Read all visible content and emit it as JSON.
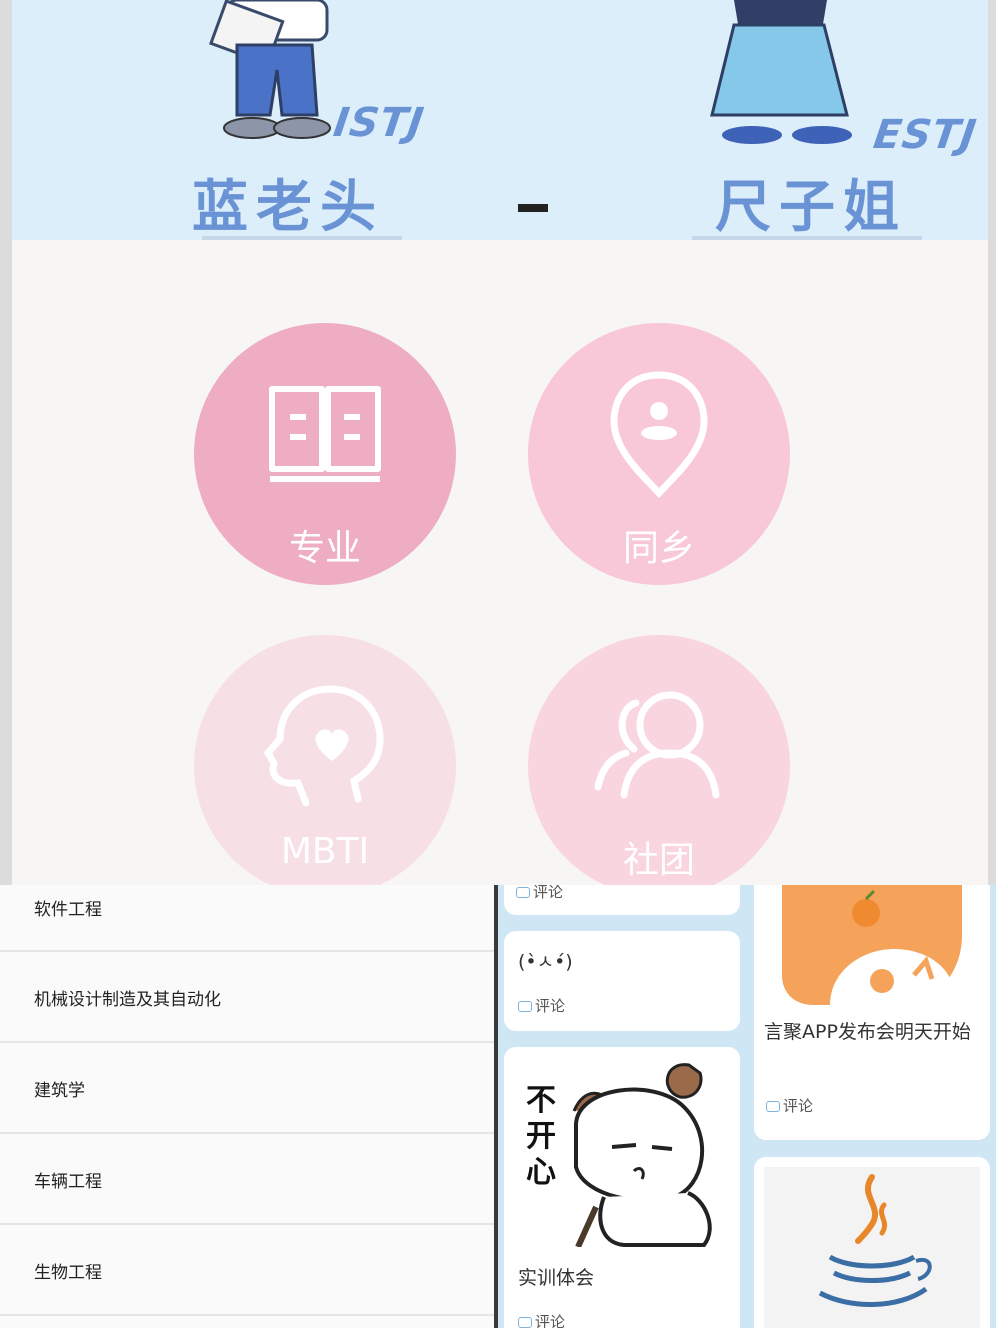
{
  "banner": {
    "left_mbti": "ISTJ",
    "left_name": "蓝老头",
    "separator": "-",
    "right_mbti": "ESTJ",
    "right_name": "尺子姐",
    "bg_color": "#dceefa"
  },
  "categories": [
    {
      "label": "专业",
      "icon": "book-icon",
      "color": "#eeadc2"
    },
    {
      "label": "同乡",
      "icon": "location-pin-icon",
      "color": "#f8c8d8"
    },
    {
      "label": "MBTI",
      "icon": "head-heart-icon",
      "color": "#f6e0e5"
    },
    {
      "label": "社团",
      "icon": "people-icon",
      "color": "#f8d5df"
    }
  ],
  "majors_list": {
    "items": [
      "软件工程",
      "机械设计制造及其自动化",
      "建筑学",
      "车辆工程",
      "生物工程"
    ]
  },
  "feed": {
    "comment_label": "评论",
    "cards": [
      {
        "text": "",
        "image": ""
      },
      {
        "text": "(•̀ㅅ•́)",
        "image": ""
      },
      {
        "text": "实训体会",
        "image": "cat-sticker-image",
        "sticker_text": "不开心"
      },
      {
        "text": "言聚APP发布会明天开始",
        "image": "orange-app-logo-image"
      },
      {
        "text": "",
        "image": "java-logo-image"
      }
    ]
  }
}
